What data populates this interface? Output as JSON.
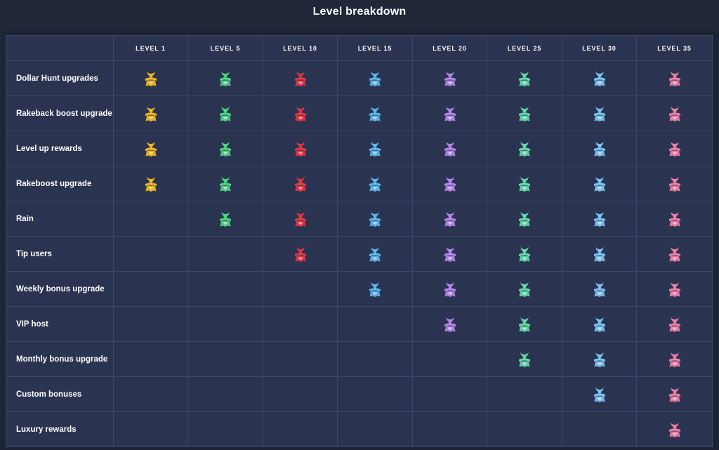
{
  "title": "Level breakdown",
  "levels": [
    "LEVEL 1",
    "LEVEL 5",
    "LEVEL 10",
    "LEVEL 15",
    "LEVEL 20",
    "LEVEL 25",
    "LEVEL 30",
    "LEVEL 35"
  ],
  "level_icon": "samurai-helmet-icon",
  "level_colors": [
    "#f5b81a",
    "#4fd483",
    "#e8333f",
    "#5bb8ee",
    "#b585ec",
    "#63d9a8",
    "#7ec4f2",
    "#f07ea6"
  ],
  "features": [
    {
      "label": "Dollar Hunt upgrades",
      "from_level_index": 0
    },
    {
      "label": "Rakeback boost upgrade",
      "from_level_index": 0
    },
    {
      "label": "Level up rewards",
      "from_level_index": 0
    },
    {
      "label": "Rakeboost upgrade",
      "from_level_index": 0
    },
    {
      "label": "Rain",
      "from_level_index": 1
    },
    {
      "label": "Tip users",
      "from_level_index": 2
    },
    {
      "label": "Weekly bonus upgrade",
      "from_level_index": 3
    },
    {
      "label": "VIP host",
      "from_level_index": 4
    },
    {
      "label": "Monthly bonus upgrade",
      "from_level_index": 5
    },
    {
      "label": "Custom bonuses",
      "from_level_index": 6
    },
    {
      "label": "Luxury rewards",
      "from_level_index": 7
    }
  ]
}
